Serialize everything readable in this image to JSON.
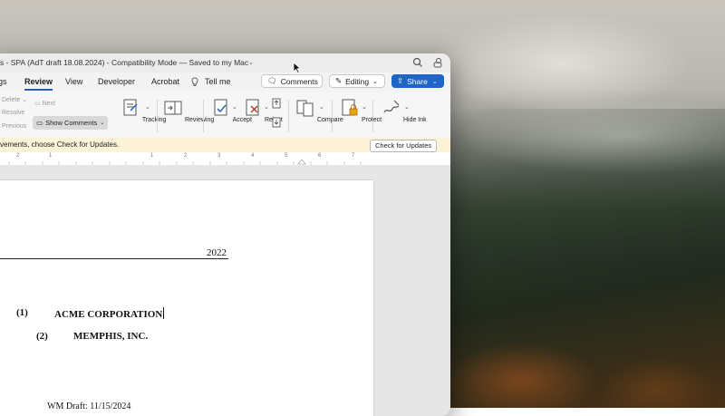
{
  "window": {
    "title": "s - SPA (AdT draft 18.08.2024)  -  Compatibility Mode — Saved to my Mac"
  },
  "tabs": {
    "items": [
      "gs",
      "Review",
      "View",
      "Developer",
      "Acrobat",
      "Tell me"
    ],
    "active": "Review",
    "comments_label": "Comments",
    "editing_label": "Editing",
    "share_label": "Share"
  },
  "ribbon": {
    "delete_label": "Delete",
    "resolve_label": "Resolve",
    "previous_label": "Previous",
    "next_label": "Next",
    "show_comments_label": "Show Comments",
    "tracking_label": "Tracking",
    "reviewing_label": "Reviewing",
    "accept_label": "Accept",
    "reject_label": "Reject",
    "compare_label": "Compare",
    "protect_label": "Protect",
    "hide_ink_label": "Hide Ink"
  },
  "infobar": {
    "message": "vements, choose Check for Updates.",
    "button_label": "Check for Updates"
  },
  "ruler": {
    "numbers": [
      "2",
      "1",
      "1",
      "2",
      "3",
      "4",
      "5",
      "6",
      "7"
    ]
  },
  "document": {
    "year": "2022",
    "party1_num": "(1)",
    "party1_name": "ACME CORPORATION",
    "party2_num": "(2)",
    "party2_name": "MEMPHIS, INC.",
    "draft_note": "WM Draft: 11/15/2024"
  },
  "colors": {
    "accent": "#1f64c7",
    "infobar_bg": "#fcf3d8"
  }
}
